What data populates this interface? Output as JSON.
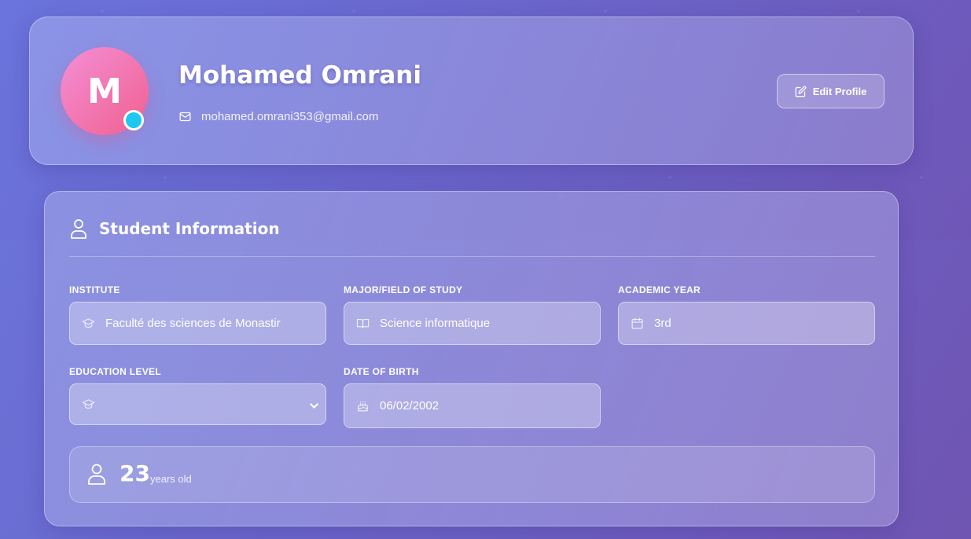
{
  "profile": {
    "initial": "M",
    "name": "Mohamed Omrani",
    "email": "mohamed.omrani353@gmail.com",
    "edit_label": "Edit Profile",
    "status_color": "#1ec8f0"
  },
  "student_info": {
    "title": "Student Information",
    "fields": [
      {
        "label": "INSTITUTE",
        "value": "Faculté des sciences de Monastir",
        "icon": "graduation-cap-icon"
      },
      {
        "label": "MAJOR/FIELD OF STUDY",
        "value": "Science informatique",
        "icon": "book-icon"
      },
      {
        "label": "ACADEMIC YEAR",
        "value": "3rd",
        "icon": "calendar-icon"
      },
      {
        "label": "EDUCATION LEVEL",
        "value": "",
        "icon": "graduation-cap-icon",
        "type": "select"
      },
      {
        "label": "DATE OF BIRTH",
        "value": "06/02/2002",
        "icon": "cake-icon"
      }
    ],
    "age": {
      "number": "23",
      "unit": "years old",
      "icon": "user-icon"
    }
  }
}
